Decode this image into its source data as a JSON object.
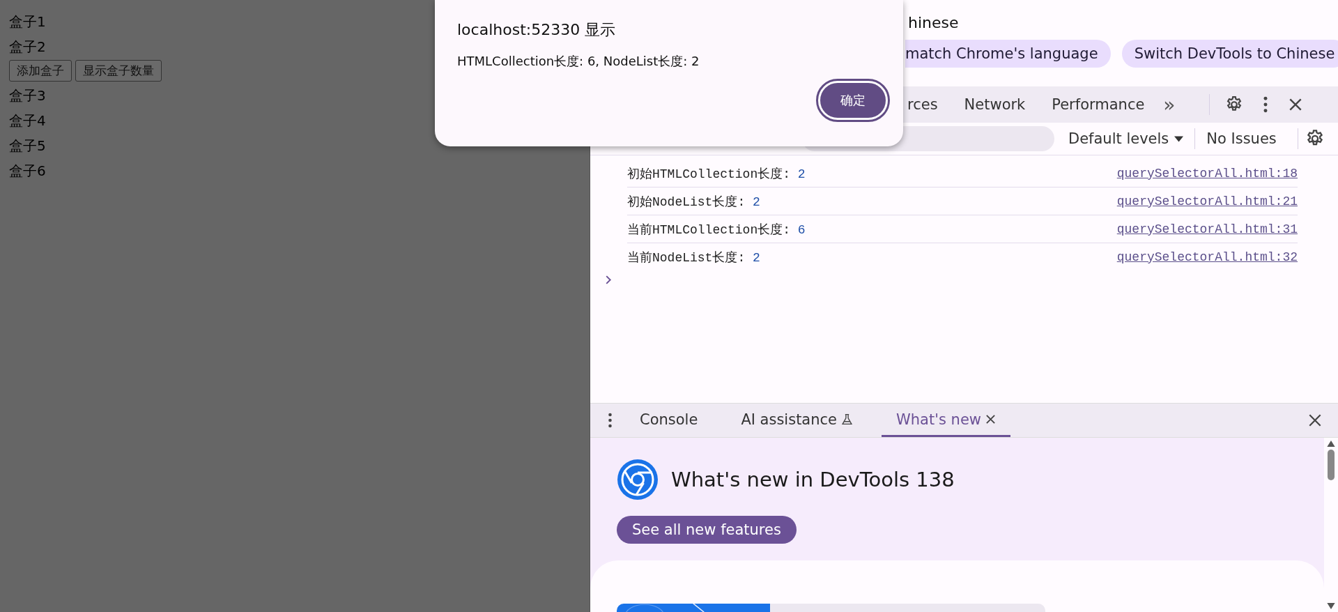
{
  "page": {
    "boxes_before": [
      "盒子1",
      "盒子2"
    ],
    "buttons": [
      "添加盒子",
      "显示盒子数量"
    ],
    "boxes_after": [
      "盒子3",
      "盒子4",
      "盒子5",
      "盒子6"
    ]
  },
  "dialog": {
    "title": "localhost:52330 显示",
    "message": "HTMLCollection长度: 6, NodeList长度: 2",
    "ok": "确定"
  },
  "devtools": {
    "banner": {
      "title": "hinese",
      "buttons": [
        "match Chrome's language",
        "Switch DevTools to Chinese"
      ]
    },
    "tabs": [
      {
        "label": "rces",
        "selected": false
      },
      {
        "label": "Network",
        "selected": false
      },
      {
        "label": "Performance",
        "selected": false
      }
    ],
    "more_tabs": "»",
    "console_toolbar": {
      "levels": "Default levels",
      "issues": "No Issues"
    },
    "messages": [
      {
        "text": "初始HTMLCollection长度: ",
        "value": "2",
        "source": "querySelectorAll.html:18"
      },
      {
        "text": "初始NodeList长度: ",
        "value": "2",
        "source": "querySelectorAll.html:21"
      },
      {
        "text": "当前HTMLCollection长度: ",
        "value": "6",
        "source": "querySelectorAll.html:31"
      },
      {
        "text": "当前NodeList长度: ",
        "value": "2",
        "source": "querySelectorAll.html:32"
      }
    ],
    "drawer": {
      "tabs": [
        {
          "label": "Console",
          "kind": "plain",
          "selected": false
        },
        {
          "label": "AI assistance",
          "kind": "experiment",
          "selected": false
        },
        {
          "label": "What's new",
          "kind": "closable",
          "selected": true
        }
      ],
      "whats_new": {
        "title": "What's new in DevTools 138",
        "button": "See all new features"
      }
    }
  }
}
